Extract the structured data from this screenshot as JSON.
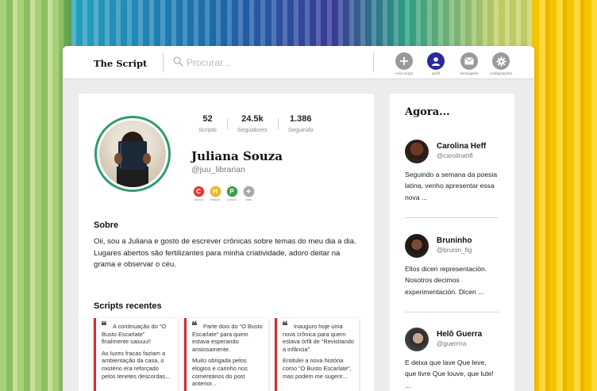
{
  "app": {
    "title": "The Script",
    "search_placeholder": "Procurar..."
  },
  "nav": [
    {
      "label": "novo script",
      "icon": "plus-icon"
    },
    {
      "label": "perfil",
      "icon": "user-icon"
    },
    {
      "label": "mensagens",
      "icon": "mail-icon"
    },
    {
      "label": "configurações",
      "icon": "gear-icon"
    }
  ],
  "profile": {
    "name": "Juliana Souza",
    "handle": "@juu_librarian",
    "stats": [
      {
        "value": "52",
        "label": "Scripts"
      },
      {
        "value": "24.5k",
        "label": "Seguidores"
      },
      {
        "value": "1.386",
        "label": "Seguindo"
      }
    ],
    "badges": [
      {
        "letter": "C",
        "label": "crônica",
        "color": "#e03a2f"
      },
      {
        "letter": "H",
        "label": "história",
        "color": "#f5b814"
      },
      {
        "letter": "P",
        "label": "poesia",
        "color": "#3aa14a"
      },
      {
        "letter": "+",
        "label": "mais",
        "color": "#a8a8a8"
      }
    ],
    "about_title": "Sobre",
    "about_text": "Oii, sou a Juliana e gosto de escrever crônicas sobre temas do meu dia a dia. Lugares abertos são fertilizantes para minha criatividade, adoro deitar na grama e observar o céu.",
    "recent_title": "Scripts recentes",
    "recent_scripts": [
      {
        "p1": "A continuação do “O Busto Escarlate” finalmente saiuuu!!",
        "p2": "As luzes fracas faziam a ambientação da casa, o mistério era reforçado pelos tenetes descordas..."
      },
      {
        "p1": "Parte dois do “O Busto Escarlate” para quem estava esperando ansiosamente.",
        "p2": "Muito obrigada pelos elogios e carinho nos comentários do post anterior..."
      },
      {
        "p1": "Inauguro hoje uma nova crônica para quem estava órfã de “Revisitando a infância”.",
        "p2": "Entitulei a nova história como “O Busto Escarlate”, mas podem me sugerir..."
      }
    ]
  },
  "agora": {
    "title": "Agora...",
    "posts": [
      {
        "name": "Carolina Heff",
        "handle": "@carolinahfl",
        "text": "Seguindo a semana da poesia latina, venho apresentar essa nova ..."
      },
      {
        "name": "Bruninho",
        "handle": "@brunin_fig",
        "text": "Ellos dicen representación. Nosotros decimos experimentación. Dicen ..."
      },
      {
        "name": "Helô Guerra",
        "handle": "@guerrrra",
        "text": "E deixa que lave Que leve, que livre Que louve, que lute! ..."
      }
    ]
  }
}
